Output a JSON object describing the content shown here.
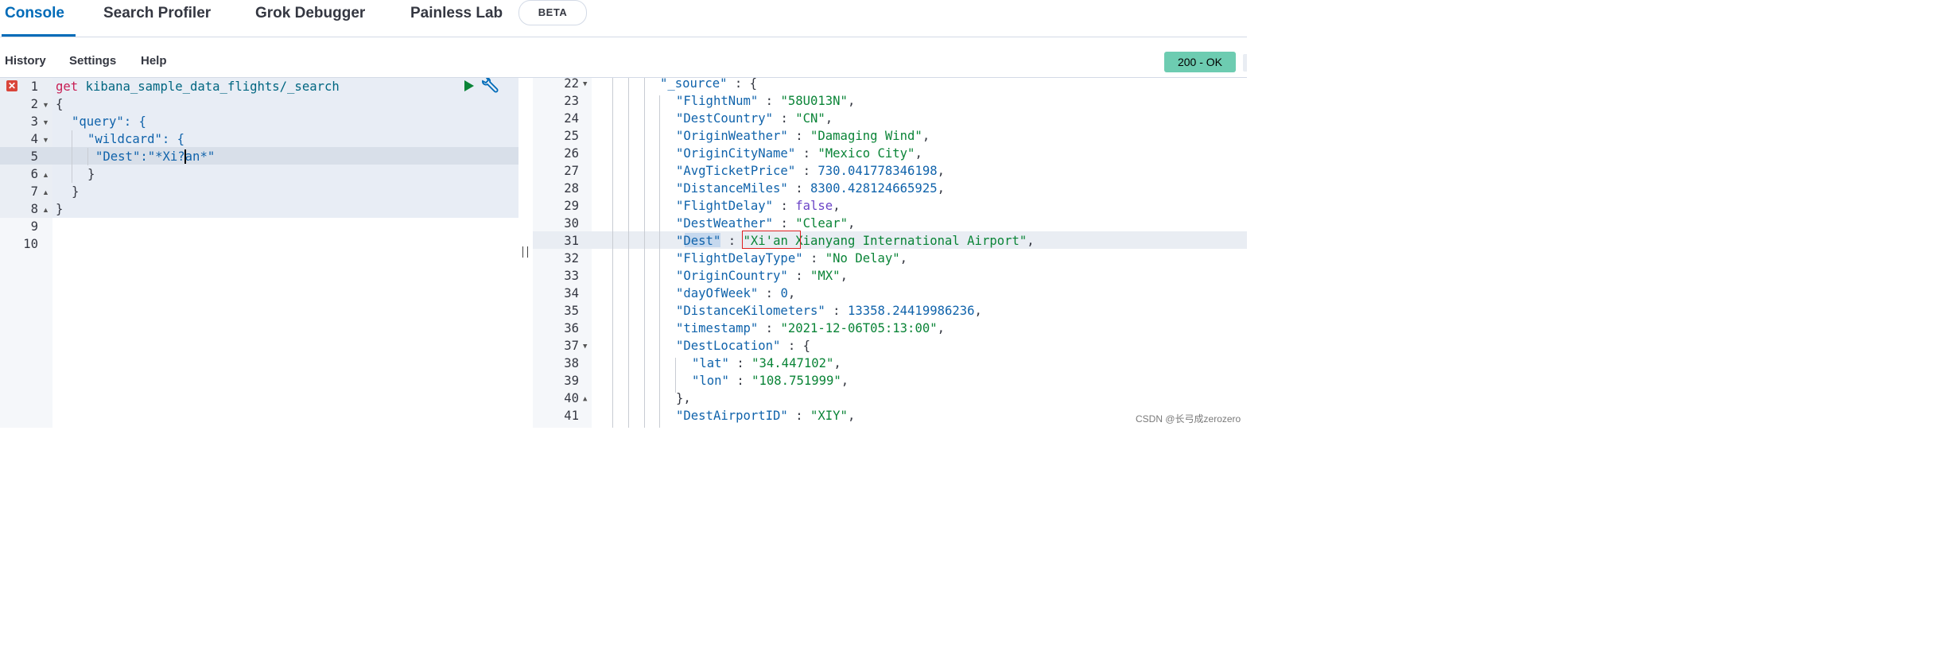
{
  "tabs": [
    {
      "label": "Console",
      "active": true
    },
    {
      "label": "Search Profiler",
      "active": false
    },
    {
      "label": "Grok Debugger",
      "active": false
    },
    {
      "label": "Painless Lab",
      "active": false
    }
  ],
  "beta_badge": "BETA",
  "toolbar": {
    "history": "History",
    "settings": "Settings",
    "help": "Help"
  },
  "status": {
    "label": "200 - OK",
    "color": "#6dccb1"
  },
  "request": {
    "line_numbers": [
      "1",
      "2",
      "3",
      "4",
      "5",
      "6",
      "7",
      "8",
      "9",
      "10"
    ],
    "method": "get",
    "path": "kibana_sample_data_flights/_search",
    "lines": [
      "{",
      "\"query\": {",
      "\"wildcard\": {",
      "\"Dest\":\"*Xi",
      "an*\"",
      "}",
      "}",
      "}"
    ]
  },
  "response": {
    "line_numbers": [
      "22",
      "23",
      "24",
      "25",
      "26",
      "27",
      "28",
      "29",
      "30",
      "31",
      "32",
      "33",
      "34",
      "35",
      "36",
      "37",
      "38",
      "39",
      "40",
      "41"
    ],
    "source_key": "\"_source\"",
    "fields": [
      {
        "key": "\"FlightNum\"",
        "value": "\"58U013N\"",
        "type": "str"
      },
      {
        "key": "\"DestCountry\"",
        "value": "\"CN\"",
        "type": "str"
      },
      {
        "key": "\"OriginWeather\"",
        "value": "\"Damaging Wind\"",
        "type": "str"
      },
      {
        "key": "\"OriginCityName\"",
        "value": "\"Mexico City\"",
        "type": "str"
      },
      {
        "key": "\"AvgTicketPrice\"",
        "value": "730.041778346198",
        "type": "num"
      },
      {
        "key": "\"DistanceMiles\"",
        "value": "8300.428124665925",
        "type": "num"
      },
      {
        "key": "\"FlightDelay\"",
        "value": "false",
        "type": "bool"
      },
      {
        "key": "\"DestWeather\"",
        "value": "\"Clear\"",
        "type": "str"
      },
      {
        "key": "\"Dest\"",
        "value": "\"Xi'an Xianyang International Airport\"",
        "type": "str"
      },
      {
        "key": "\"FlightDelayType\"",
        "value": "\"No Delay\"",
        "type": "str"
      },
      {
        "key": "\"OriginCountry\"",
        "value": "\"MX\"",
        "type": "str"
      },
      {
        "key": "\"dayOfWeek\"",
        "value": "0",
        "type": "num"
      },
      {
        "key": "\"DistanceKilometers\"",
        "value": "13358.24419986236",
        "type": "num"
      },
      {
        "key": "\"timestamp\"",
        "value": "\"2021-12-06T05:13:00\"",
        "type": "str"
      },
      {
        "key": "\"DestLocation\"",
        "value": "{",
        "type": "punc"
      },
      {
        "key": "\"lat\"",
        "value": "\"34.447102\"",
        "type": "str"
      },
      {
        "key": "\"lon\"",
        "value": "\"108.751999\"",
        "type": "str"
      },
      {
        "key": "",
        "value": "},",
        "type": "punc"
      },
      {
        "key": "\"DestAirportID\"",
        "value": "\"XIY\"",
        "type": "str"
      }
    ]
  },
  "watermark": "CSDN @长弓成zerozero",
  "colors": {
    "accent": "#006bb8",
    "error": "#d9453a",
    "highlight_box": "#e02020"
  }
}
